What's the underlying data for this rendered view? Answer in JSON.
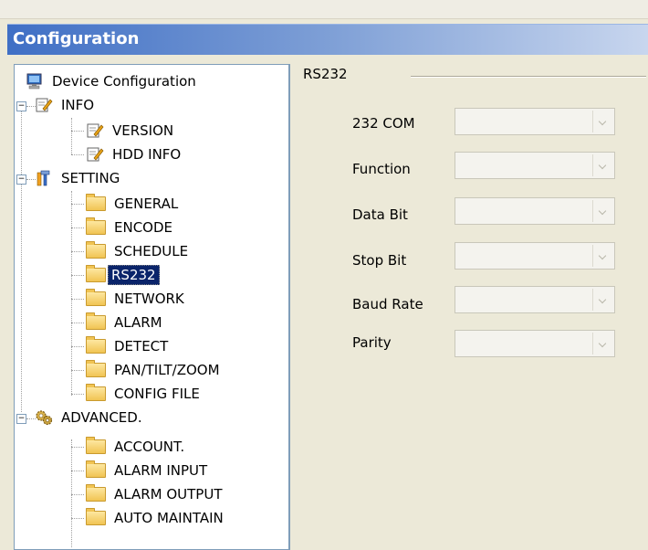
{
  "window": {
    "title": "Configuration"
  },
  "tree": {
    "root": "Device Configuration",
    "info": {
      "label": "INFO",
      "children": [
        "VERSION",
        "HDD INFO"
      ]
    },
    "setting": {
      "label": "SETTING",
      "children": [
        "GENERAL",
        "ENCODE",
        "SCHEDULE",
        "RS232",
        "NETWORK",
        "ALARM",
        "DETECT",
        "PAN/TILT/ZOOM",
        "CONFIG FILE"
      ]
    },
    "advanced": {
      "label": "ADVANCED.",
      "children": [
        "ACCOUNT.",
        "ALARM INPUT",
        "ALARM OUTPUT",
        "AUTO MAINTAIN"
      ]
    },
    "selected": "RS232"
  },
  "panel": {
    "title": "RS232",
    "fields": [
      {
        "label": "232 COM",
        "value": ""
      },
      {
        "label": "Function",
        "value": ""
      },
      {
        "label": "Data Bit",
        "value": ""
      },
      {
        "label": "Stop Bit",
        "value": ""
      },
      {
        "label": "Baud Rate",
        "value": ""
      },
      {
        "label": "Parity",
        "value": ""
      }
    ]
  },
  "colors": {
    "title_gradient_start": "#3F6FC5",
    "selection": "#0A246A",
    "tree_border": "#7f9db9"
  }
}
